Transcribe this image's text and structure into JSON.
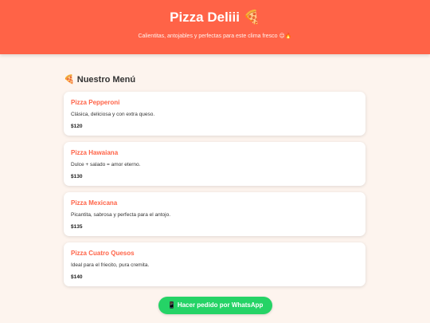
{
  "header": {
    "title": "Pizza Deliii",
    "title_emoji": "🍕",
    "subtitle": "Calientitas, antojables y perfectas para este clima fresco",
    "subtitle_emojis": "😌🔥"
  },
  "menu": {
    "title_emoji": "🍕",
    "title": "Nuestro Menú",
    "items": [
      {
        "name": "Pizza Pepperoni",
        "description": "Clásica, deliciosa y con extra queso.",
        "price": "$120"
      },
      {
        "name": "Pizza Hawaiana",
        "description": "Dulce + salado = amor eterno.",
        "price": "$130"
      },
      {
        "name": "Pizza Mexicana",
        "description": "Picantita, sabrosa y perfecta para el antojo.",
        "price": "$135"
      },
      {
        "name": "Pizza Cuatro Quesos",
        "description": "Ideal para el friecito, pura cremita.",
        "price": "$140"
      }
    ]
  },
  "order_button": {
    "icon": "📱",
    "label": "Hacer pedido por WhatsApp"
  },
  "colors": {
    "header_bg": "#ff6347",
    "accent": "#ff6347",
    "whatsapp": "#25d366",
    "page_bg": "#fdf4ee"
  }
}
